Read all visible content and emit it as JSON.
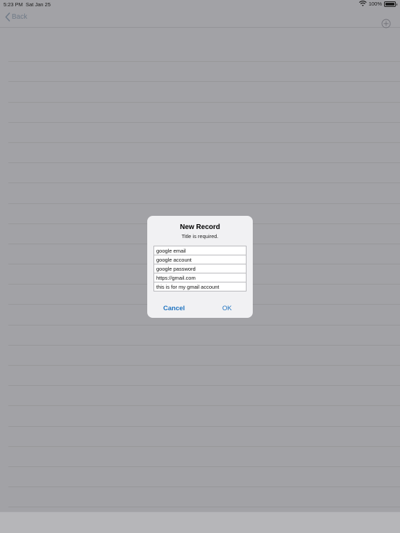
{
  "status_bar": {
    "time": "5:23 PM",
    "date": "Sat Jan 25",
    "battery": "100%"
  },
  "nav": {
    "back_label": "Back"
  },
  "alert": {
    "title": "New Record",
    "message": "Title is required.",
    "fields": [
      {
        "value": "google email"
      },
      {
        "value": "google account"
      },
      {
        "value": "google password"
      },
      {
        "value": "https://gmail.com"
      },
      {
        "value": "this is for my gmail account"
      }
    ],
    "cancel_label": "Cancel",
    "ok_label": "OK"
  },
  "colors": {
    "accent": "#1f73c0",
    "overlay": "#a2a2a6",
    "alert_bg": "#f1f1f3"
  },
  "icons": [
    "wifi-icon",
    "battery-icon",
    "chevron-left-icon",
    "plus-circle-icon"
  ]
}
